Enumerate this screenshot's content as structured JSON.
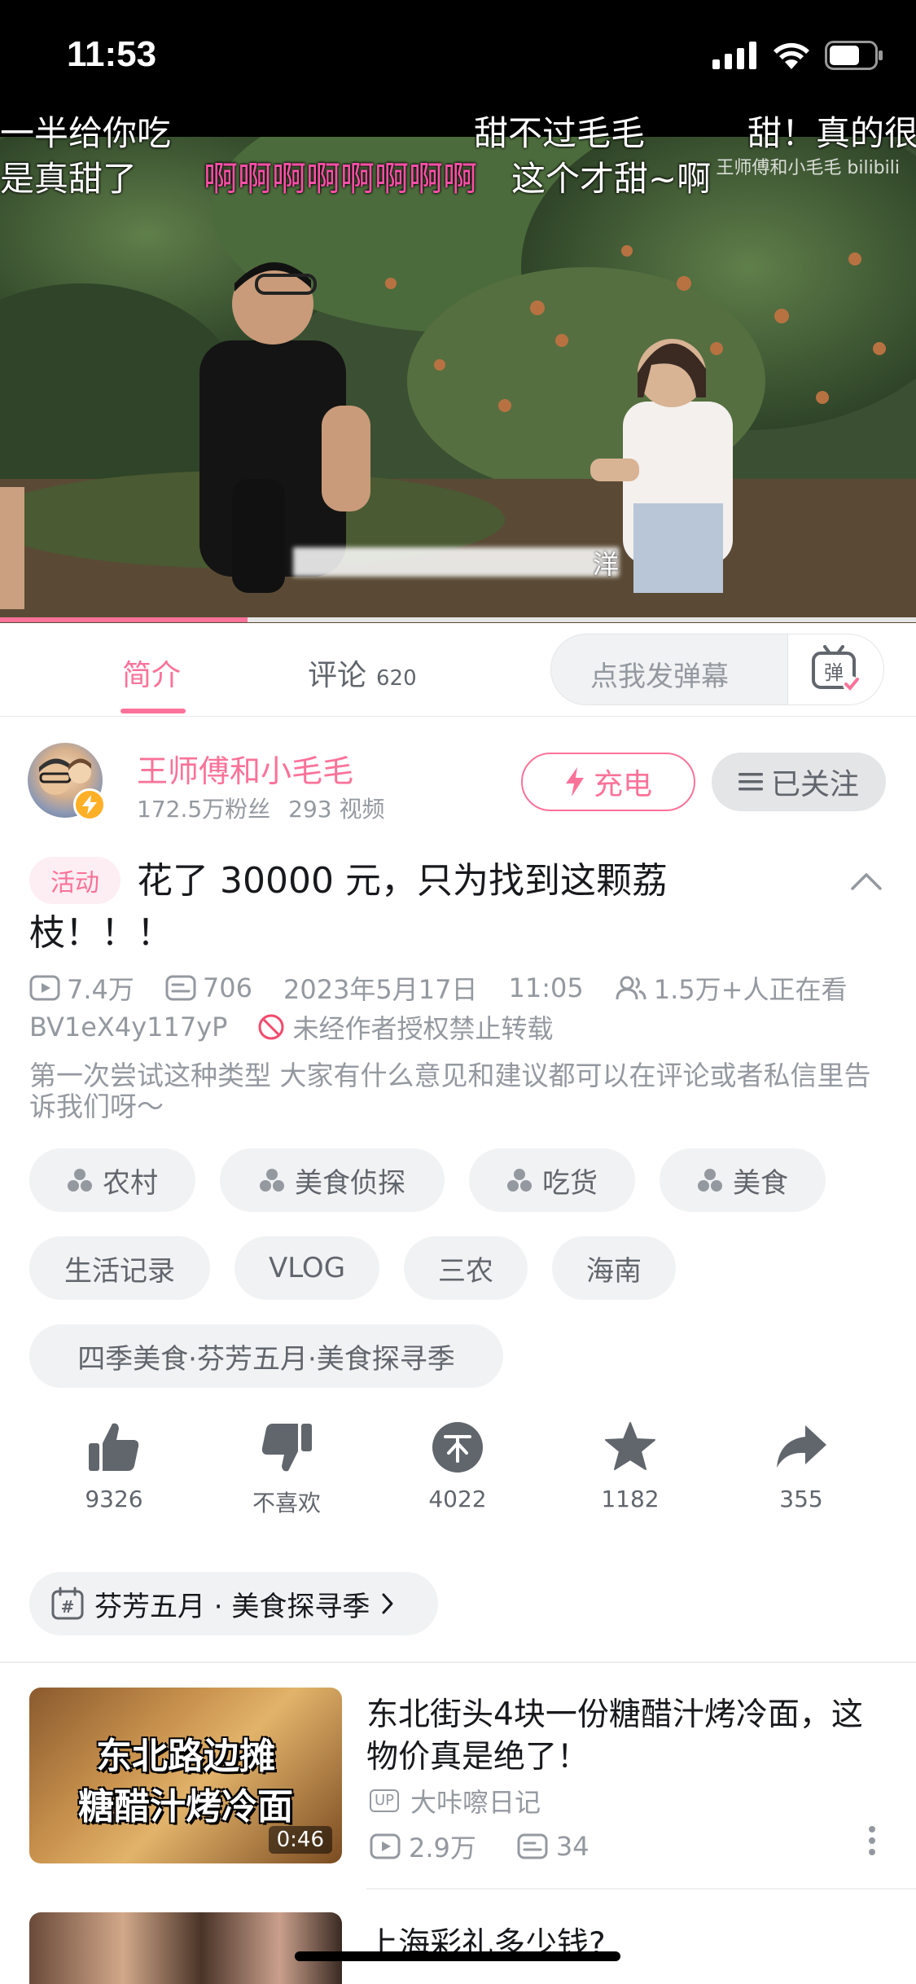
{
  "status_bar": {
    "time": "11:53"
  },
  "video": {
    "danmaku": [
      "一半给你吃",
      "甜不过毛毛",
      "甜！真的很",
      "是真甜了",
      "啊啊啊啊啊啊啊啊",
      "这个才甜~啊"
    ],
    "watermark": "王师傅和小毛毛 bilibili",
    "subtitle_tail": "洋",
    "progress_percent": 27
  },
  "tabs": {
    "intro_label": "简介",
    "comments_label": "评论",
    "comments_count": "620",
    "danmaku_placeholder": "点我发弹幕",
    "danmaku_button": "弹"
  },
  "uploader": {
    "name": "王师傅和小毛毛",
    "followers": "172.5万粉丝",
    "videos": "293 视频",
    "charge_label": "充电",
    "follow_label": "已关注"
  },
  "video_info": {
    "badge": "活动",
    "title": "花了 30000 元，只为找到这颗荔枝！！！",
    "views": "7.4万",
    "danmaku_count": "706",
    "date": "2023年5月17日",
    "time": "11:05",
    "watching": "1.5万+人正在看",
    "bvid": "BV1eX4y117yP",
    "repost_notice": "未经作者授权禁止转载",
    "description": "第一次尝试这种类型 大家有什么意见和建议都可以在评论或者私信里告诉我们呀～"
  },
  "tags": {
    "row1": [
      "农村",
      "美食侦探",
      "吃货",
      "美食"
    ],
    "row2": [
      "生活记录",
      "VLOG",
      "三农",
      "海南"
    ],
    "row3": [
      "四季美食·芬芳五月·美食探寻季"
    ]
  },
  "actions": {
    "like": "9326",
    "dislike": "不喜欢",
    "coin": "4022",
    "favorite": "1182",
    "share": "355"
  },
  "activity_link": "芬芳五月 · 美食探寻季",
  "related": [
    {
      "thumb_line1": "东北路边摊",
      "thumb_line2": "糖醋汁烤冷面",
      "duration": "0:46",
      "title": "东北街头4块一份糖醋汁烤冷面，这物价真是绝了！",
      "up_tag": "UP",
      "author": "大咔嚓日记",
      "views": "2.9万",
      "danmaku": "34"
    },
    {
      "title": "上海彩礼多少钱?"
    }
  ],
  "colors": {
    "accent": "#fb7299",
    "text": "#18191c",
    "muted": "#9499a0",
    "chip": "#f1f2f3"
  }
}
